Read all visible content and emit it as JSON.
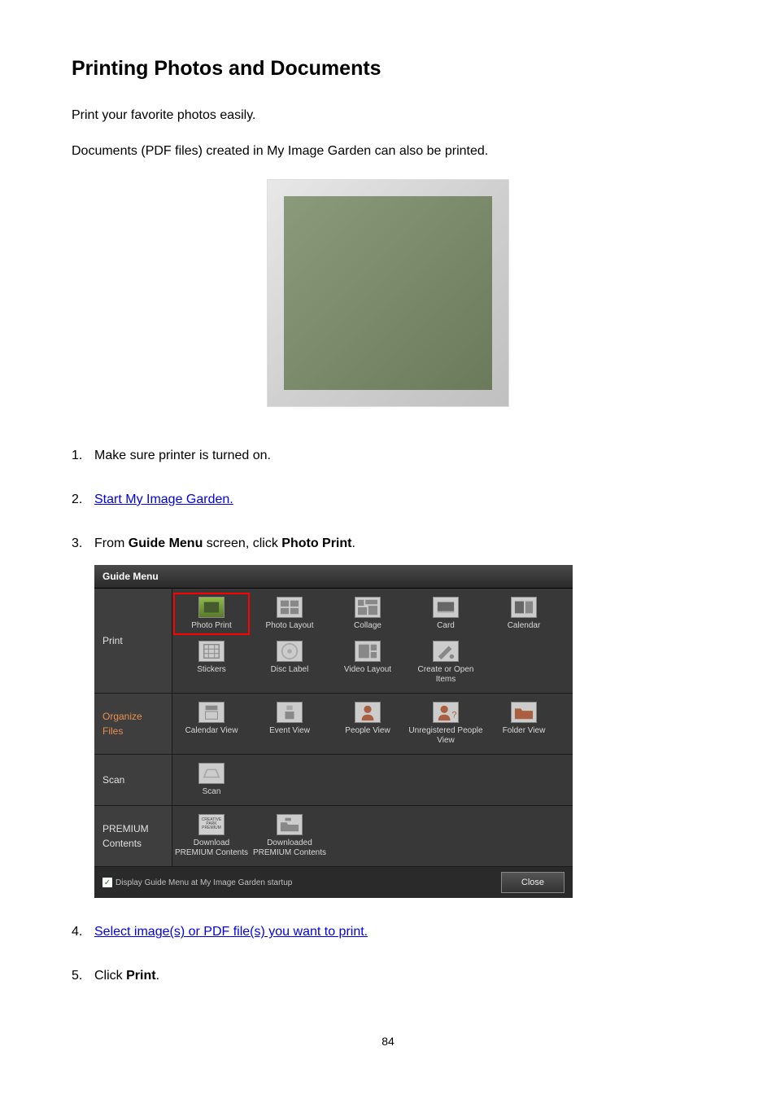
{
  "title": "Printing Photos and Documents",
  "intro": [
    "Print your favorite photos easily.",
    "Documents (PDF files) created in My Image Garden can also be printed."
  ],
  "steps": {
    "s1": "Make sure printer is turned on.",
    "s2_link": "Start My Image Garden.",
    "s3_pre": "From ",
    "s3_b1": "Guide Menu",
    "s3_mid": " screen, click ",
    "s3_b2": "Photo Print",
    "s3_post": ".",
    "s4_link": "Select image(s) or PDF file(s) you want to print.",
    "s5_pre": "Click ",
    "s5_b": "Print",
    "s5_post": "."
  },
  "guide_menu": {
    "header": "Guide Menu",
    "sections": {
      "print": {
        "label": "Print",
        "items": [
          "Photo Print",
          "Photo Layout",
          "Collage",
          "Card",
          "Calendar",
          "Stickers",
          "Disc Label",
          "Video Layout",
          "Create or Open Items"
        ]
      },
      "organize": {
        "label": "Organize Files",
        "items": [
          "Calendar View",
          "Event View",
          "People View",
          "Unregistered People View",
          "Folder View"
        ]
      },
      "scan": {
        "label": "Scan",
        "items": [
          "Scan"
        ]
      },
      "premium": {
        "label": "PREMIUM Contents",
        "items": [
          "Download PREMIUM Contents",
          "Downloaded PREMIUM Contents"
        ]
      }
    },
    "footer_check": "Display Guide Menu at My Image Garden startup",
    "close": "Close"
  },
  "page_number": "84"
}
